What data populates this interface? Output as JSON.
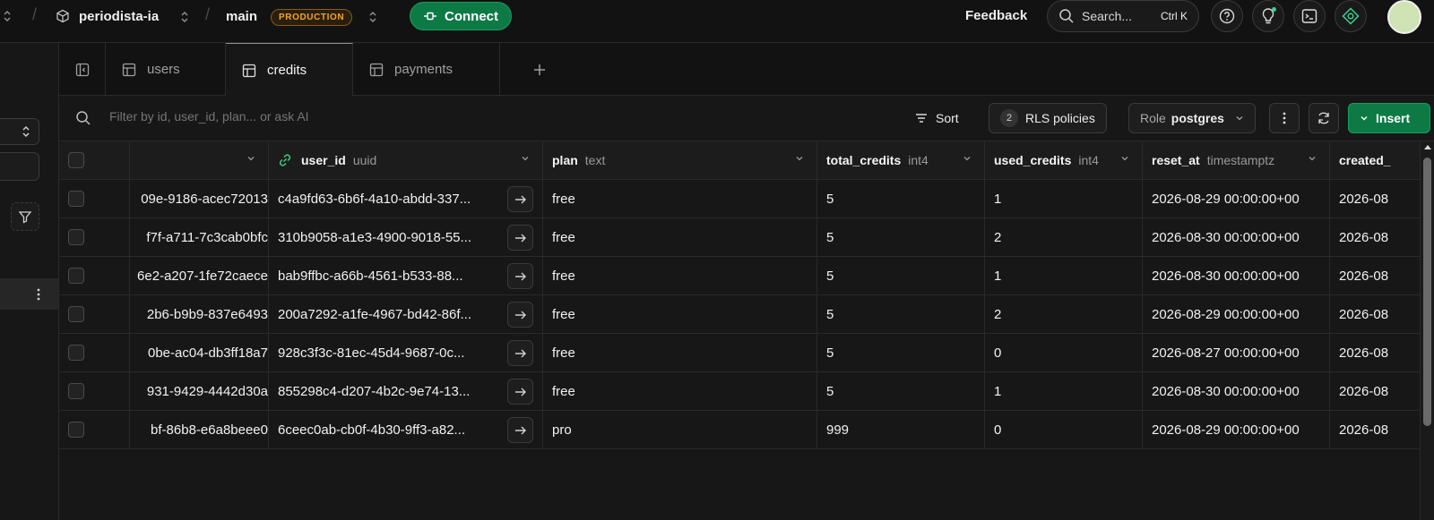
{
  "topbar": {
    "project": "periodista-ia",
    "branch": "main",
    "branch_badge": "PRODUCTION",
    "connect_label": "Connect",
    "feedback_label": "Feedback",
    "search_placeholder": "Search...",
    "search_shortcut": "Ctrl K"
  },
  "tabs": [
    {
      "label": "users",
      "active": false
    },
    {
      "label": "credits",
      "active": true
    },
    {
      "label": "payments",
      "active": false
    }
  ],
  "toolbar": {
    "filter_placeholder": "Filter by id, user_id, plan... or ask AI",
    "sort_label": "Sort",
    "rls_count": "2",
    "rls_label": "RLS policies",
    "role_label": "Role",
    "role_value": "postgres",
    "insert_label": "Insert"
  },
  "columns": {
    "user_id": {
      "name": "user_id",
      "type": "uuid"
    },
    "plan": {
      "name": "plan",
      "type": "text"
    },
    "total_credits": {
      "name": "total_credits",
      "type": "int4"
    },
    "used_credits": {
      "name": "used_credits",
      "type": "int4"
    },
    "reset_at": {
      "name": "reset_at",
      "type": "timestamptz"
    },
    "created": {
      "name": "created_"
    }
  },
  "rows": [
    {
      "id": "09e-9186-acec72013",
      "user_id": "c4a9fd63-6b6f-4a10-abdd-337...",
      "plan": "free",
      "total_credits": "5",
      "used_credits": "1",
      "reset_at": "2026-08-29 00:00:00+00",
      "created": "2026-08"
    },
    {
      "id": "f7f-a711-7c3cab0bfc",
      "user_id": "310b9058-a1e3-4900-9018-55...",
      "plan": "free",
      "total_credits": "5",
      "used_credits": "2",
      "reset_at": "2026-08-30 00:00:00+00",
      "created": "2026-08"
    },
    {
      "id": "6e2-a207-1fe72caece",
      "user_id": "bab9ffbc-a66b-4561-b533-88...",
      "plan": "free",
      "total_credits": "5",
      "used_credits": "1",
      "reset_at": "2026-08-30 00:00:00+00",
      "created": "2026-08"
    },
    {
      "id": "2b6-b9b9-837e6493",
      "user_id": "200a7292-a1fe-4967-bd42-86f...",
      "plan": "free",
      "total_credits": "5",
      "used_credits": "2",
      "reset_at": "2026-08-29 00:00:00+00",
      "created": "2026-08"
    },
    {
      "id": "0be-ac04-db3ff18a7",
      "user_id": "928c3f3c-81ec-45d4-9687-0c...",
      "plan": "free",
      "total_credits": "5",
      "used_credits": "0",
      "reset_at": "2026-08-27 00:00:00+00",
      "created": "2026-08"
    },
    {
      "id": "931-9429-4442d30a",
      "user_id": "855298c4-d207-4b2c-9e74-13...",
      "plan": "free",
      "total_credits": "5",
      "used_credits": "1",
      "reset_at": "2026-08-30 00:00:00+00",
      "created": "2026-08"
    },
    {
      "id": "bf-86b8-e6a8beee0",
      "user_id": "6ceec0ab-cb0f-4b30-9ff3-a82...",
      "plan": "pro",
      "total_credits": "999",
      "used_credits": "0",
      "reset_at": "2026-08-29 00:00:00+00",
      "created": "2026-08"
    }
  ],
  "colors": {
    "accent_green": "#0d7a45",
    "production_orange": "#f5a524",
    "background": "#171717"
  }
}
